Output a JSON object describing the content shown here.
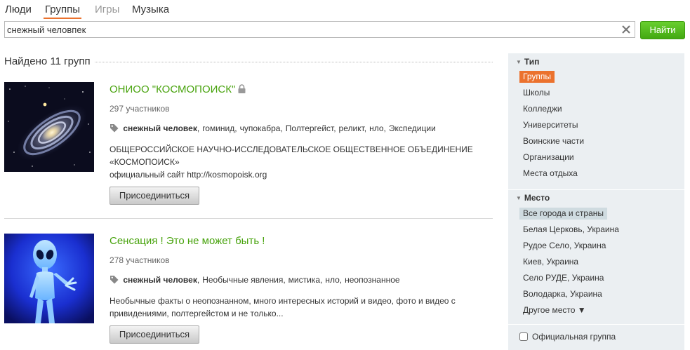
{
  "tabs": {
    "people": "Люди",
    "groups": "Группы",
    "games": "Игры",
    "music": "Музыка",
    "active": "groups"
  },
  "search": {
    "value": "снежный человпек",
    "button_label": "Найти"
  },
  "results": {
    "title": "Найдено 11 групп"
  },
  "groups": [
    {
      "title": "ОНИОО \"КОСМОПОИСК\"",
      "private": true,
      "members": "297 участников",
      "tags": [
        "снежный человек",
        "гоминид",
        "чупокабра",
        "Полтергейст",
        "реликт",
        "нло",
        "Экспедиции"
      ],
      "description": [
        "ОБЩЕРОССИЙСКОЕ НАУЧНО-ИССЛЕДОВАТЕЛЬСКОЕ ОБЩЕСТВЕННОЕ ОБЪЕДИНЕНИЕ",
        "«КОСМОПОИСК»",
        "официальный сайт http://kosmopoisk.org"
      ],
      "join_label": "Присоединиться"
    },
    {
      "title": "Сенсация ! Это не может быть !",
      "private": false,
      "members": "278 участников",
      "tags": [
        "снежный человек",
        "Необычные явления",
        "мистика",
        "нло",
        "неопознанное"
      ],
      "description": [
        "Необычные факты о неопознанном, много интересных  историй и видео, фото и видео с",
        "привидениями, полтергейстом и не только..."
      ],
      "join_label": "Присоединиться"
    }
  ],
  "sidebar": {
    "type": {
      "heading": "Тип",
      "items": [
        "Группы",
        "Школы",
        "Колледжи",
        "Университеты",
        "Воинские части",
        "Организации",
        "Места отдыха"
      ],
      "selected": 0
    },
    "place": {
      "heading": "Место",
      "items": [
        "Все города и страны",
        "Белая Церковь, Украина",
        "Рудое Село, Украина",
        "Киев, Украина",
        "Село РУДЕ, Украина",
        "Володарка, Украина",
        "Другое место ▼"
      ],
      "selected": 0
    },
    "official": {
      "label": "Официальная группа",
      "checked": false
    }
  },
  "colors": {
    "accent_orange": "#eb722e",
    "link_green": "#48a30d",
    "button_green": "#4fb81a",
    "sidebar_bg": "#ebeff2"
  }
}
